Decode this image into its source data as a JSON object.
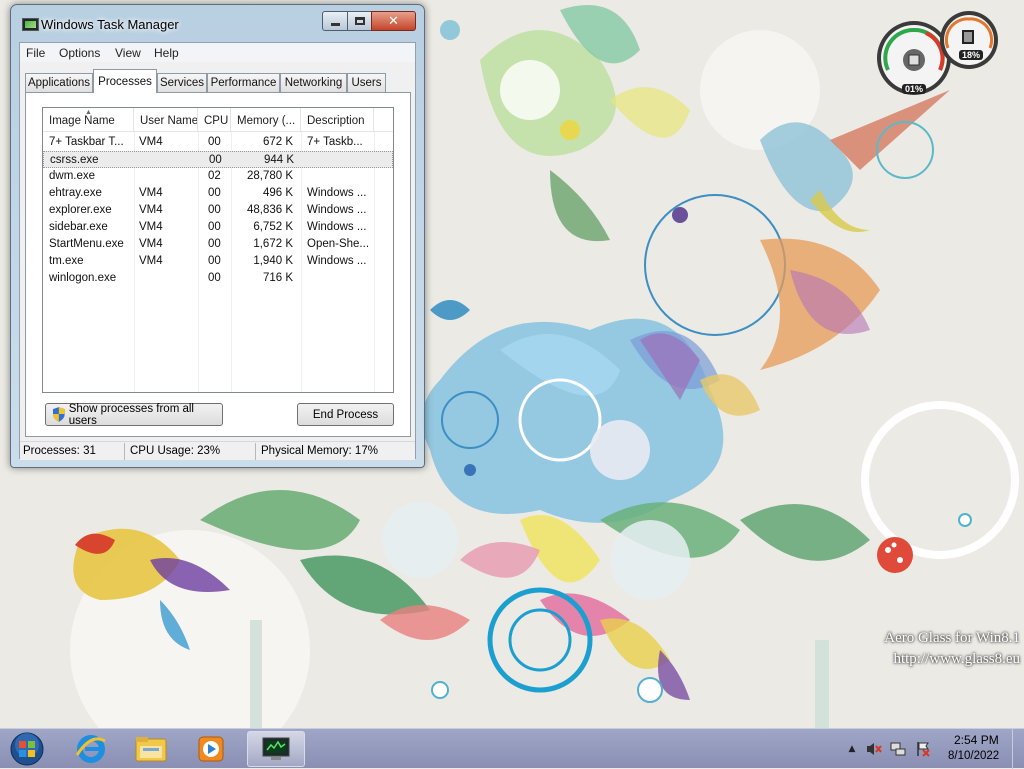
{
  "window": {
    "title": "Windows Task Manager",
    "menu": [
      "File",
      "Options",
      "View",
      "Help"
    ],
    "tabs": [
      "Applications",
      "Processes",
      "Services",
      "Performance",
      "Networking",
      "Users"
    ],
    "active_tab": "Processes"
  },
  "processes": {
    "columns": [
      "Image Name",
      "User Name",
      "CPU",
      "Memory (...",
      "Description"
    ],
    "sorted_column": "Image Name",
    "selected_row": 1,
    "rows": [
      {
        "name": "7+ Taskbar T...",
        "user": "VM4",
        "cpu": "00",
        "memory": "672 K",
        "description": "7+ Taskb..."
      },
      {
        "name": "csrss.exe",
        "user": "",
        "cpu": "00",
        "memory": "944 K",
        "description": ""
      },
      {
        "name": "dwm.exe",
        "user": "",
        "cpu": "02",
        "memory": "28,780 K",
        "description": ""
      },
      {
        "name": "ehtray.exe",
        "user": "VM4",
        "cpu": "00",
        "memory": "496 K",
        "description": "Windows ..."
      },
      {
        "name": "explorer.exe",
        "user": "VM4",
        "cpu": "00",
        "memory": "48,836 K",
        "description": "Windows ..."
      },
      {
        "name": "sidebar.exe",
        "user": "VM4",
        "cpu": "00",
        "memory": "6,752 K",
        "description": "Windows ..."
      },
      {
        "name": "StartMenu.exe",
        "user": "VM4",
        "cpu": "00",
        "memory": "1,672 K",
        "description": "Open-She..."
      },
      {
        "name": "tm.exe",
        "user": "VM4",
        "cpu": "00",
        "memory": "1,940 K",
        "description": "Windows ..."
      },
      {
        "name": "winlogon.exe",
        "user": "",
        "cpu": "00",
        "memory": "716 K",
        "description": ""
      }
    ],
    "show_all_label": "Show processes from all users",
    "end_process_label": "End Process"
  },
  "status_bar": {
    "processes": "Processes: 31",
    "cpu": "CPU Usage: 23%",
    "memory": "Physical Memory: 17%"
  },
  "gadget": {
    "cpu_label": "01%",
    "memory_label": "18%"
  },
  "watermark": {
    "line1": "Aero Glass for Win8.1",
    "line2": "http://www.glass8.eu"
  },
  "taskbar": {
    "pinned": [
      "start-orb-icon",
      "internet-explorer-icon",
      "file-explorer-icon",
      "media-player-icon",
      "task-manager-icon"
    ],
    "tray_icons": [
      "chevron-up-icon",
      "speaker-muted-icon",
      "network-icon",
      "action-center-flag-icon"
    ],
    "clock_time": "2:54 PM",
    "clock_date": "8/10/2022"
  },
  "colors": {
    "taskbar": "#9399bd",
    "close_button": "#c2452b",
    "glass_frame": "#b4cde1"
  }
}
